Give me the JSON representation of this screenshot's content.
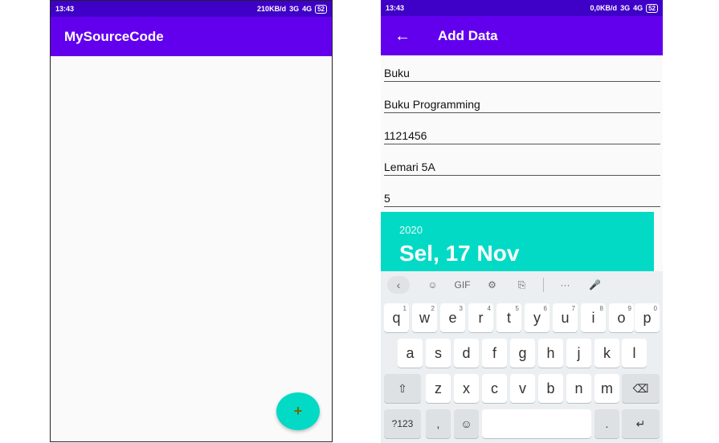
{
  "phone1": {
    "status": {
      "time": "13:43",
      "speed": "210KB/d",
      "net1": "3G",
      "net2": "4G",
      "battery": "52"
    },
    "appbar": {
      "title": "MySourceCode"
    },
    "fab": {
      "icon": "+"
    }
  },
  "phone2": {
    "status": {
      "time": "13:43",
      "speed": "0,0KB/d",
      "net1": "3G",
      "net2": "4G",
      "battery": "52"
    },
    "appbar": {
      "back": "←",
      "title": "Add Data"
    },
    "fields": [
      "Buku",
      "Buku Programming",
      "1121456",
      "Lemari 5A",
      "5"
    ],
    "date": {
      "year": "2020",
      "full": "Sel, 17 Nov"
    },
    "keyboard": {
      "toolbar": {
        "collapse": "‹",
        "sticker": "☺",
        "gif": "GIF",
        "settings": "⚙",
        "translate": "⎘",
        "more": "···",
        "mic": "🎤"
      },
      "row1": [
        {
          "k": "q",
          "n": "1"
        },
        {
          "k": "w",
          "n": "2"
        },
        {
          "k": "e",
          "n": "3"
        },
        {
          "k": "r",
          "n": "4"
        },
        {
          "k": "t",
          "n": "5"
        },
        {
          "k": "y",
          "n": "6"
        },
        {
          "k": "u",
          "n": "7"
        },
        {
          "k": "i",
          "n": "8"
        },
        {
          "k": "o",
          "n": "9"
        },
        {
          "k": "p",
          "n": "0"
        }
      ],
      "row2": [
        "a",
        "s",
        "d",
        "f",
        "g",
        "h",
        "j",
        "k",
        "l"
      ],
      "row3": [
        "z",
        "x",
        "c",
        "v",
        "b",
        "n",
        "m"
      ],
      "shift": "⇧",
      "backspace": "⌫",
      "symbols": "?123",
      "comma": ",",
      "emoji": "☺",
      "period": ".",
      "enter": "↵"
    }
  }
}
